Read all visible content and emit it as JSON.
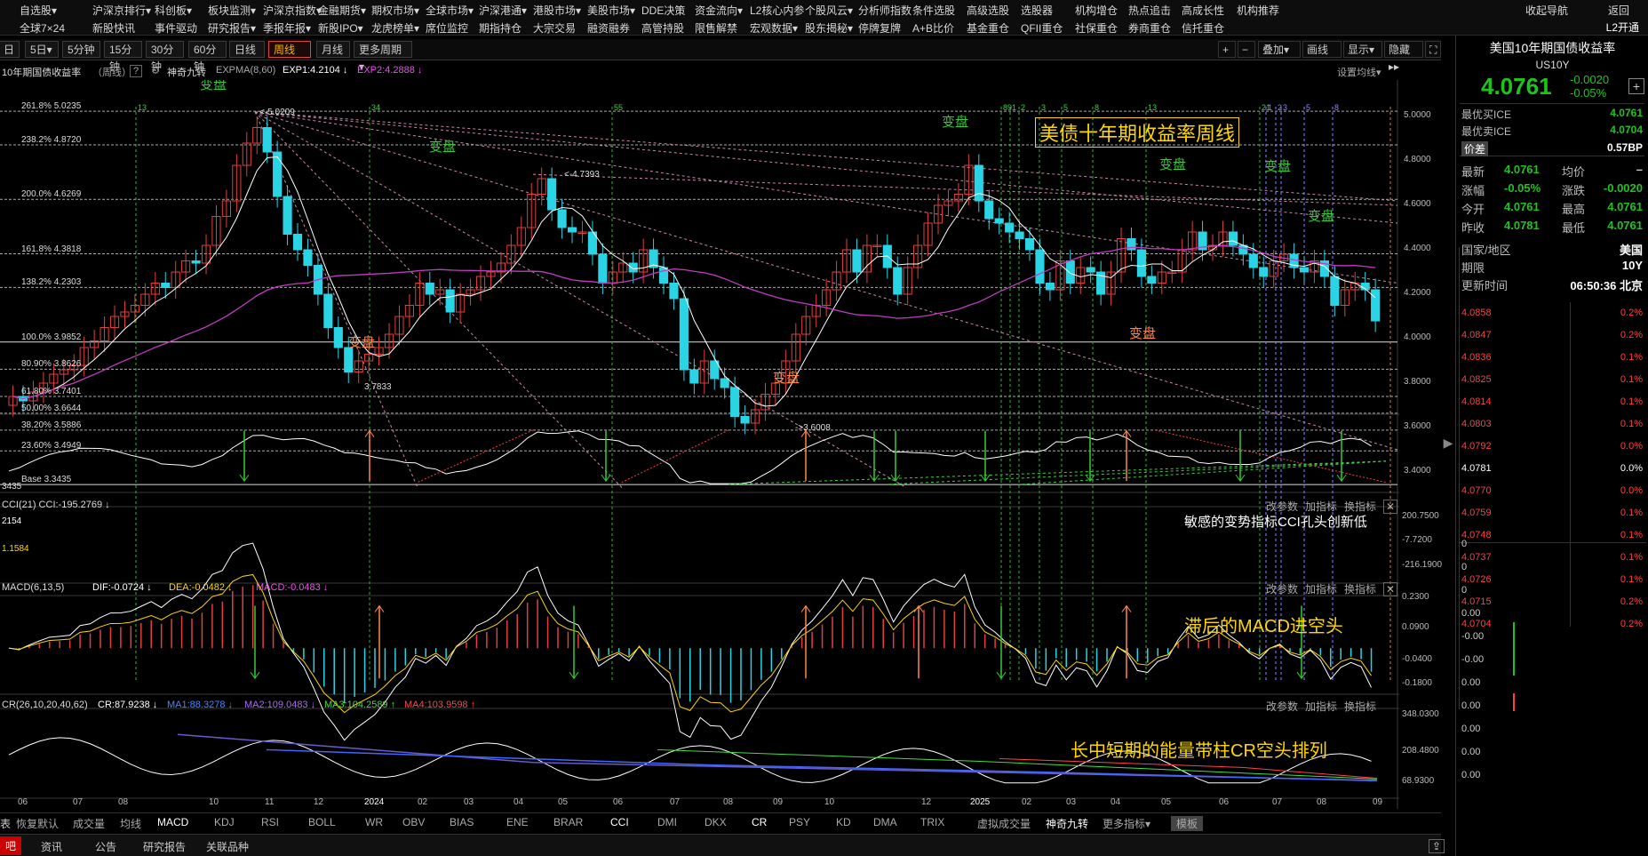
{
  "menu": {
    "row1": [
      "自选股▾",
      "沪深京排行▾",
      "科创板▾",
      "板块监测▾",
      "沪深京指数▾",
      "金融期货▾",
      "期权市场▾",
      "全球市场▾",
      "沪深港通▾",
      "港股市场▾",
      "美股市场▾",
      "DDE决策",
      "资金流向▾",
      "L2核心内参",
      "个股风云▾",
      "分析师指数",
      "条件选股",
      "高级选股",
      "选股器",
      "机构增仓",
      "热点追击",
      "高成长性",
      "机构推荐"
    ],
    "row2": [
      "全球7×24",
      "新股快讯",
      "事件驱动",
      "研究报告▾",
      "季报年报▾",
      "新股IPO▾",
      "龙虎榜单▾",
      "席位监控",
      "期指持仓",
      "大宗交易",
      "融资融券",
      "高管持股",
      "限售解禁",
      "宏观数据▾",
      "股东揭秘▾",
      "停牌复牌",
      "A+B比价",
      "基金重仓",
      "QFII重仓",
      "社保重仓",
      "券商重仓",
      "信托重仓"
    ],
    "right": [
      "收起导航",
      "返回"
    ],
    "l2": "L2开通"
  },
  "toolbar": {
    "periods": [
      "日",
      "5日▾",
      "5分钟",
      "15分钟",
      "30分钟",
      "60分钟",
      "日线",
      "周线",
      "月线",
      "更多周期▾"
    ],
    "selected": "周线",
    "right": [
      "+",
      "−",
      "叠加▾",
      "画线",
      "显示▾",
      "隐藏▸▸"
    ]
  },
  "info": {
    "name": "10年期国债收益率",
    "period": "（周线）",
    "help": "?",
    "indicator": "神奇九转",
    "expma": "EXPMA(8,60)",
    "exp1": "EXP1:4.2104 ↓",
    "exp2": "EXP2:4.2888 ↓",
    "settings": "设置均线▾"
  },
  "fib": [
    {
      "t": "261.8% 5.0235",
      "v": 5.0235
    },
    {
      "t": "238.2% 4.8720",
      "v": 4.872
    },
    {
      "t": "200.0% 4.6269",
      "v": 4.6269
    },
    {
      "t": "161.8% 4.3818",
      "v": 4.3818
    },
    {
      "t": "138.2% 4.2303",
      "v": 4.2303
    },
    {
      "t": "100.0% 3.9852",
      "v": 3.9852
    },
    {
      "t": "80.90% 3.8626",
      "v": 3.8626
    },
    {
      "t": "61.80% 3.7401",
      "v": 3.7401
    },
    {
      "t": "50.00% 3.6644",
      "v": 3.6644
    },
    {
      "t": "38.20% 3.5886",
      "v": 3.5886
    },
    {
      "t": "23.60% 3.4949",
      "v": 3.4949
    },
    {
      "t": "Base 3.3435",
      "v": 3.3435
    }
  ],
  "main_axis": [
    "5.0000",
    "4.8000",
    "4.6000",
    "4.4000",
    "4.2000",
    "4.0000",
    "3.8000",
    "3.6000",
    "3.4000"
  ],
  "main_labels": {
    "high": "5.0209",
    "h2": "4.7393",
    "low1": "3.7833",
    "low2": "3.6008",
    "base_left": "3435",
    "title": "美债十年期收益率周线",
    "turn": "变盘"
  },
  "counts": [
    "13",
    "34",
    "55",
    "89",
    "1",
    "2",
    "3",
    "5",
    "8",
    "13",
    "21",
    "1",
    "2",
    "3",
    "5",
    "8"
  ],
  "cci": {
    "head": "CCI(21) CCI:-195.2769 ↓",
    "v1": "2154",
    "v2": "1.1584",
    "axis": [
      "200.7500",
      "-7.7200",
      "-216.1900"
    ],
    "note": "敏感的变势指标CCI孔头创新低"
  },
  "macd": {
    "head": "MACD(6,13,5)",
    "dif": "DIF:-0.0724 ↓",
    "dea": "DEA:-0.0482 ↓",
    "macd": "MACD:-0.0483 ↓",
    "axis": [
      "0.2300",
      "0.0900",
      "-0.0400",
      "-0.1800"
    ],
    "note": "滞后的MACD进空头"
  },
  "cr": {
    "head": "CR(26,10,20,40,62)",
    "cr": "CR:87.9238 ↓",
    "ma1": "MA1:88.3278 ↓",
    "ma2": "MA2:109.0483 ↓",
    "ma3": "MA3:104.2589 ↑",
    "ma4": "MA4:103.9598 ↑",
    "axis": [
      "348.0300",
      "208.4800",
      "68.9300"
    ],
    "note": "长中短期的能量带柱CR空头排列"
  },
  "ind_btns": [
    "改参数",
    "加指标",
    "换指标"
  ],
  "xaxis": [
    "06",
    "07",
    "08",
    "10",
    "11",
    "12",
    "2024",
    "02",
    "03",
    "04",
    "05",
    "06",
    "07",
    "08",
    "09",
    "10",
    "12",
    "2025",
    "02",
    "03",
    "04",
    "05",
    "06",
    "07",
    "08",
    "09"
  ],
  "tabs": [
    "恢复默认",
    "成交量",
    "均线",
    "MACD",
    "KDJ",
    "RSI",
    "BOLL",
    "WR",
    "OBV",
    "BIAS",
    "ENE",
    "BRAR",
    "CCI",
    "DMI",
    "DKX",
    "CR",
    "PSY",
    "KD",
    "DMA",
    "TRIX",
    "虚拟成交量",
    "神奇九转",
    "更多指标▾",
    "模板"
  ],
  "bottom": [
    "吧",
    "资讯",
    "公告",
    "研究报告",
    "关联品种"
  ],
  "quote": {
    "title": "美国10年期国债收益率",
    "code": "US10Y",
    "price": "4.0761",
    "chg": "-0.0020",
    "pct": "-0.05%",
    "bid_label": "最优买ICE",
    "bid": "4.0761",
    "ask_label": "最优卖ICE",
    "ask": "4.0704",
    "spread_label": "价差",
    "spread": "0.57BP",
    "rows": [
      [
        "最新",
        "4.0761",
        "均价",
        "–"
      ],
      [
        "涨幅",
        "-0.05%",
        "涨跌",
        "-0.0020"
      ],
      [
        "今开",
        "4.0761",
        "最高",
        "4.0761"
      ],
      [
        "昨收",
        "4.0781",
        "最低",
        "4.0761"
      ]
    ],
    "info": [
      [
        "国家/地区",
        "美国"
      ],
      [
        "期限",
        "10Y"
      ],
      [
        "更新时间",
        "06:50:36 北京"
      ]
    ],
    "ladder": [
      [
        "4.0858",
        "0.2%"
      ],
      [
        "4.0847",
        "0.2%"
      ],
      [
        "4.0836",
        "0.1%"
      ],
      [
        "4.0825",
        "0.1%"
      ],
      [
        "4.0814",
        "0.1%"
      ],
      [
        "4.0803",
        "0.1%"
      ],
      [
        "4.0792",
        "0.0%"
      ],
      [
        "4.0781",
        "0.0%"
      ],
      [
        "4.0770",
        "0.0%"
      ],
      [
        "4.0759",
        "0.1%"
      ],
      [
        "4.0748",
        "0.1%"
      ],
      [
        "4.0737",
        "0.1%"
      ],
      [
        "4.0726",
        "0.1%"
      ],
      [
        "4.0715",
        "0.2%"
      ],
      [
        "4.0704",
        "0.2%"
      ]
    ],
    "mini": [
      "0",
      "0",
      "0",
      "0.00",
      "-0.00",
      "-0.00",
      "0.00",
      "0.00",
      "0.00",
      "0.00",
      "0.00"
    ]
  }
}
